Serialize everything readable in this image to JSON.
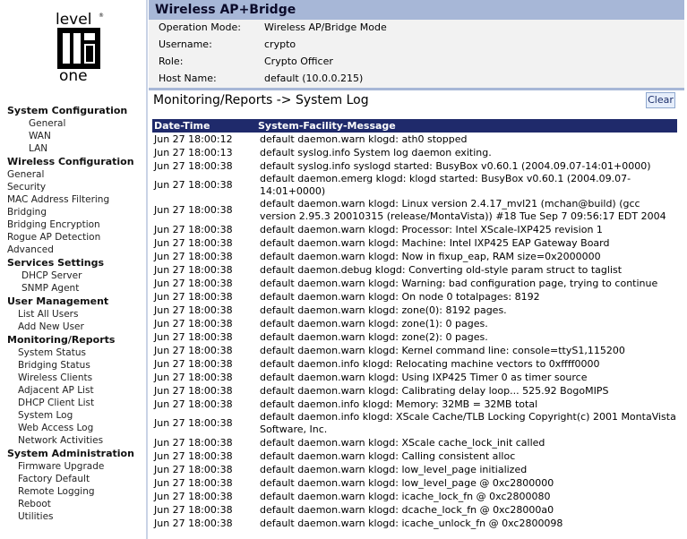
{
  "logo": {
    "top_text": "level",
    "bottom_text": "one"
  },
  "nav": [
    {
      "section": "System Configuration",
      "cls": "i1",
      "items": [
        "General",
        "WAN",
        "LAN"
      ]
    },
    {
      "section": "Wireless Configuration",
      "cls": "i3",
      "items": [
        "General",
        "Security",
        "MAC Address Filtering",
        "Bridging",
        "Bridging Encryption",
        "Rogue AP Detection",
        "Advanced"
      ]
    },
    {
      "section": "Services Settings",
      "cls": "i4",
      "items": [
        "DHCP Server",
        "SNMP Agent"
      ]
    },
    {
      "section": "User Management",
      "cls": "i2",
      "items": [
        "List All Users",
        "Add New User"
      ]
    },
    {
      "section": "Monitoring/Reports",
      "cls": "i2",
      "items": [
        "System Status",
        "Bridging Status",
        "Wireless Clients",
        "Adjacent AP List",
        "DHCP Client List",
        "System Log",
        "Web Access Log",
        "Network Activities"
      ]
    },
    {
      "section": "System Administration",
      "cls": "i2",
      "items": [
        "Firmware Upgrade",
        "Factory Default",
        "Remote Logging",
        "Reboot",
        "Utilities"
      ]
    }
  ],
  "header": {
    "title": "Wireless AP+Bridge"
  },
  "info": [
    {
      "label": "Operation Mode:",
      "value": "Wireless AP/Bridge Mode"
    },
    {
      "label": "Username:",
      "value": "crypto"
    },
    {
      "label": "Role:",
      "value": "Crypto Officer"
    },
    {
      "label": "Host Name:",
      "value": "default (10.0.0.215)"
    }
  ],
  "page": {
    "title": "Monitoring/Reports -> System Log",
    "clear_label": "Clear"
  },
  "log": {
    "columns": [
      "Date-Time",
      "System-Facility-Message"
    ],
    "rows": [
      [
        "Jun 27 18:00:12",
        "default daemon.warn klogd: ath0 stopped"
      ],
      [
        "Jun 27 18:00:13",
        "default syslog.info System log daemon exiting."
      ],
      [
        "Jun 27 18:00:38",
        "default syslog.info syslogd started: BusyBox v0.60.1 (2004.09.07-14:01+0000)"
      ],
      [
        "Jun 27 18:00:38",
        "default daemon.emerg klogd: klogd started: BusyBox v0.60.1 (2004.09.07-14:01+0000)"
      ],
      [
        "Jun 27 18:00:38",
        "default daemon.warn klogd: Linux version 2.4.17_mvl21 (mchan@build) (gcc version 2.95.3 20010315 (release/MontaVista)) #18 Tue Sep 7 09:56:17 EDT 2004"
      ],
      [
        "Jun 27 18:00:38",
        "default daemon.warn klogd: Processor: Intel XScale-IXP425 revision 1"
      ],
      [
        "Jun 27 18:00:38",
        "default daemon.warn klogd: Machine: Intel IXP425 EAP Gateway Board"
      ],
      [
        "Jun 27 18:00:38",
        "default daemon.warn klogd: Now in fixup_eap, RAM size=0x2000000"
      ],
      [
        "Jun 27 18:00:38",
        "default daemon.debug klogd: Converting old-style param struct to taglist"
      ],
      [
        "Jun 27 18:00:38",
        "default daemon.warn klogd: Warning: bad configuration page, trying to continue"
      ],
      [
        "Jun 27 18:00:38",
        "default daemon.warn klogd: On node 0 totalpages: 8192"
      ],
      [
        "Jun 27 18:00:38",
        "default daemon.warn klogd: zone(0): 8192 pages."
      ],
      [
        "Jun 27 18:00:38",
        "default daemon.warn klogd: zone(1): 0 pages."
      ],
      [
        "Jun 27 18:00:38",
        "default daemon.warn klogd: zone(2): 0 pages."
      ],
      [
        "Jun 27 18:00:38",
        "default daemon.warn klogd: Kernel command line: console=ttyS1,115200"
      ],
      [
        "Jun 27 18:00:38",
        "default daemon.info klogd: Relocating machine vectors to 0xffff0000"
      ],
      [
        "Jun 27 18:00:38",
        "default daemon.warn klogd: Using IXP425 Timer 0 as timer source"
      ],
      [
        "Jun 27 18:00:38",
        "default daemon.warn klogd: Calibrating delay loop... 525.92 BogoMIPS"
      ],
      [
        "Jun 27 18:00:38",
        "default daemon.info klogd: Memory: 32MB = 32MB total"
      ],
      [
        "Jun 27 18:00:38",
        "default daemon.info klogd: XScale Cache/TLB Locking Copyright(c) 2001 MontaVista Software, Inc."
      ],
      [
        "Jun 27 18:00:38",
        "default daemon.warn klogd: XScale cache_lock_init called"
      ],
      [
        "Jun 27 18:00:38",
        "default daemon.warn klogd: Calling consistent alloc"
      ],
      [
        "Jun 27 18:00:38",
        "default daemon.warn klogd: low_level_page initialized"
      ],
      [
        "Jun 27 18:00:38",
        "default daemon.warn klogd: low_level_page @ 0xc2800000"
      ],
      [
        "Jun 27 18:00:38",
        "default daemon.warn klogd: icache_lock_fn @ 0xc2800080"
      ],
      [
        "Jun 27 18:00:38",
        "default daemon.warn klogd: dcache_lock_fn @ 0xc28000a0"
      ],
      [
        "Jun 27 18:00:38",
        "default daemon.warn klogd: icache_unlock_fn @ 0xc2800098"
      ]
    ]
  },
  "colors": {
    "header_bg": "#a7b7d7",
    "table_header_bg": "#1f2a6b",
    "info_bg": "#f2f2f2"
  }
}
